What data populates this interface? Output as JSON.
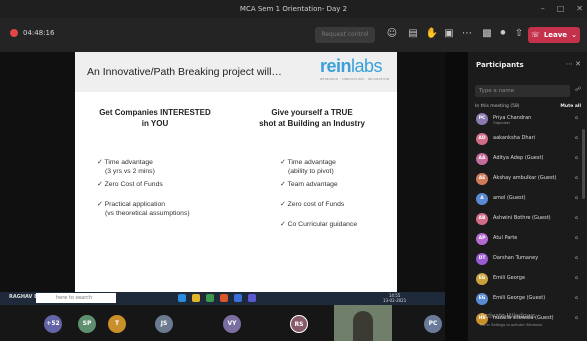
{
  "window": {
    "title": "MCA Sem 1 Orientation- Day 2"
  },
  "toolbar": {
    "timer": "04:48:16",
    "request_control": "Request control",
    "leave": "Leave"
  },
  "slide": {
    "title": "An Innovative/Path Breaking project will…",
    "logo": {
      "text_a": "rein",
      "text_b": "labs",
      "tagline": "RESEARCH · INNOVATION · INCUBATION"
    },
    "left_heading": [
      "Get Companies INTERESTED",
      "in YOU"
    ],
    "right_heading": [
      "Give yourself a TRUE",
      "shot at Building an Industry"
    ],
    "left_bullets": [
      {
        "line1": "✓ Time advantage",
        "line2": "(3 yrs vs 2 mins)"
      },
      {
        "line1": "✓ Zero Cost of Funds",
        "line2": ""
      },
      {
        "line1": "✓ Practical application",
        "line2": "(vs theoretical assumptions)"
      }
    ],
    "right_bullets": [
      {
        "line1": "✓ Time advantage",
        "line2": "(ability to pivot)"
      },
      {
        "line1": "✓ Team advantage",
        "line2": ""
      },
      {
        "line1": "✓ Zero cost of Funds",
        "line2": ""
      },
      {
        "line1": "✓ Co Curricular guidance",
        "line2": ""
      }
    ]
  },
  "taskbar": {
    "user_label": "RAGHAV BAJPAI IS PRESE",
    "search_placeholder": "here to search",
    "time": "14:55",
    "date": "13-02-2021"
  },
  "gallery": {
    "overflow_count": "+52",
    "avatars": [
      "SP",
      "T",
      "JS",
      "VY",
      "RS",
      "PC"
    ]
  },
  "participants": {
    "heading": "Participants",
    "search_placeholder": "Type a name",
    "in_meeting": "In this meeting (58)",
    "mute_all": "Mute all",
    "people": [
      {
        "initials": "PC",
        "name": "Priya Chandran",
        "role": "Organizer"
      },
      {
        "initials": "AD",
        "name": "aakanksha Dhari",
        "role": ""
      },
      {
        "initials": "AA",
        "name": "Aditya Adep (Guest)",
        "role": ""
      },
      {
        "initials": "AE",
        "name": "Akshay ambulkar (Guest)",
        "role": ""
      },
      {
        "initials": "A",
        "name": "amol (Guest)",
        "role": ""
      },
      {
        "initials": "AB",
        "name": "Ashwini Bothre (Guest)",
        "role": ""
      },
      {
        "initials": "AP",
        "name": "Atul Parte",
        "role": ""
      },
      {
        "initials": "DT",
        "name": "Darshan Tumaney",
        "role": ""
      },
      {
        "initials": "EG",
        "name": "Emili George",
        "role": ""
      },
      {
        "initials": "EG",
        "name": "Emili George (Guest)",
        "role": ""
      },
      {
        "initials": "HS",
        "name": "huzaifa sitowala (Guest)",
        "role": ""
      }
    ]
  },
  "os_watermark": {
    "line1": "Activate Windows",
    "line2": "Go to Settings to activate Windows."
  }
}
